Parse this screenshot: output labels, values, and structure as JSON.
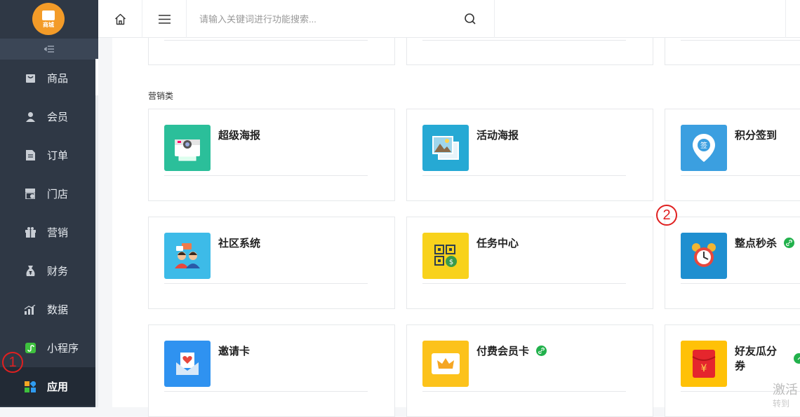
{
  "sidebar": {
    "logo_text": "商城",
    "collapse_icon": "collapse-icon",
    "items": [
      {
        "label": "商品",
        "icon": "bag-icon"
      },
      {
        "label": "会员",
        "icon": "user-icon"
      },
      {
        "label": "订单",
        "icon": "order-icon"
      },
      {
        "label": "门店",
        "icon": "store-icon"
      },
      {
        "label": "营销",
        "icon": "gift-icon"
      },
      {
        "label": "财务",
        "icon": "money-bag-icon"
      },
      {
        "label": "数据",
        "icon": "chart-icon"
      },
      {
        "label": "小程序",
        "icon": "miniprogram-icon"
      },
      {
        "label": "应用",
        "icon": "apps-icon",
        "active": true
      }
    ]
  },
  "topbar": {
    "search_placeholder": "请输入关键词进行功能搜索..."
  },
  "main": {
    "section_title": "营销类",
    "cards": [
      {
        "name": "超级海报",
        "color": "#2bbf9a",
        "icon": "camera-poster-icon"
      },
      {
        "name": "活动海报",
        "color": "#26a9d4",
        "icon": "picture-frames-icon"
      },
      {
        "name": "积分签到",
        "color": "#3b9fe0",
        "icon": "sign-pin-icon"
      },
      {
        "name": "社区系统",
        "color": "#3dbbe8",
        "icon": "community-people-icon"
      },
      {
        "name": "任务中心",
        "color": "#f8d21c",
        "icon": "qr-coin-icon"
      },
      {
        "name": "整点秒杀",
        "color": "#1f8fd0",
        "icon": "alarm-clock-icon",
        "link": true
      },
      {
        "name": "邀请卡",
        "color": "#2f92f0",
        "icon": "invite-heart-icon"
      },
      {
        "name": "付费会员卡",
        "color": "#fcc21b",
        "icon": "crown-card-icon",
        "link": true
      },
      {
        "name": "好友瓜分券",
        "color": "#ffc107",
        "icon": "red-envelope-icon",
        "link": true
      }
    ]
  },
  "annotations": {
    "mark1": "1",
    "mark2": "2"
  },
  "watermark": {
    "line1": "激活",
    "line2": "转到"
  }
}
